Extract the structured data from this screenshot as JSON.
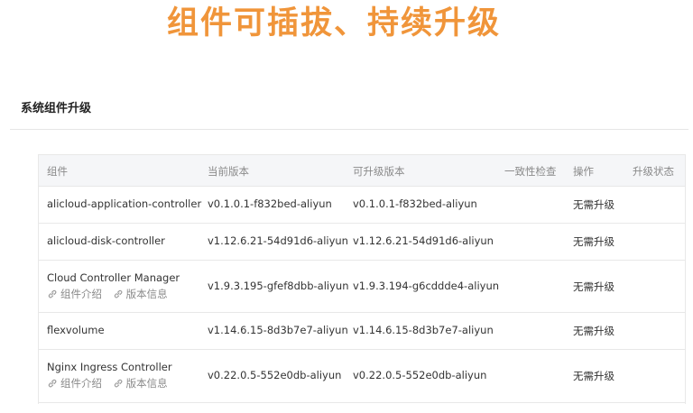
{
  "banner": {
    "text": "组件可插拔、持续升级"
  },
  "section": {
    "title": "系统组件升级"
  },
  "table": {
    "headers": {
      "component": "组件",
      "current_version": "当前版本",
      "upgradable_version": "可升级版本",
      "consistency_check": "一致性检查",
      "action": "操作",
      "upgrade_status": "升级状态"
    },
    "rows": [
      {
        "name": "alicloud-application-controller",
        "current": "v0.1.0.1-f832bed-aliyun",
        "upgradable": "v0.1.0.1-f832bed-aliyun",
        "check": "",
        "action": "无需升级",
        "status": ""
      },
      {
        "name": "alicloud-disk-controller",
        "current": "v1.12.6.21-54d91d6-aliyun",
        "upgradable": "v1.12.6.21-54d91d6-aliyun",
        "check": "",
        "action": "无需升级",
        "status": ""
      },
      {
        "name": "Cloud Controller Manager",
        "intro": "组件介绍",
        "info": "版本信息",
        "current": "v1.9.3.195-gfef8dbb-aliyun",
        "upgradable": "v1.9.3.194-g6cddde4-aliyun",
        "check": "",
        "action": "无需升级",
        "status": ""
      },
      {
        "name": "flexvolume",
        "current": "v1.14.6.15-8d3b7e7-aliyun",
        "upgradable": "v1.14.6.15-8d3b7e7-aliyun",
        "check": "",
        "action": "无需升级",
        "status": ""
      },
      {
        "name": "Nginx Ingress Controller",
        "intro": "组件介绍",
        "info": "版本信息",
        "current": "v0.22.0.5-552e0db-aliyun",
        "upgradable": "v0.22.0.5-552e0db-aliyun",
        "check": "",
        "action": "无需升级",
        "status": ""
      }
    ]
  },
  "icons": {
    "link": "link-icon"
  }
}
